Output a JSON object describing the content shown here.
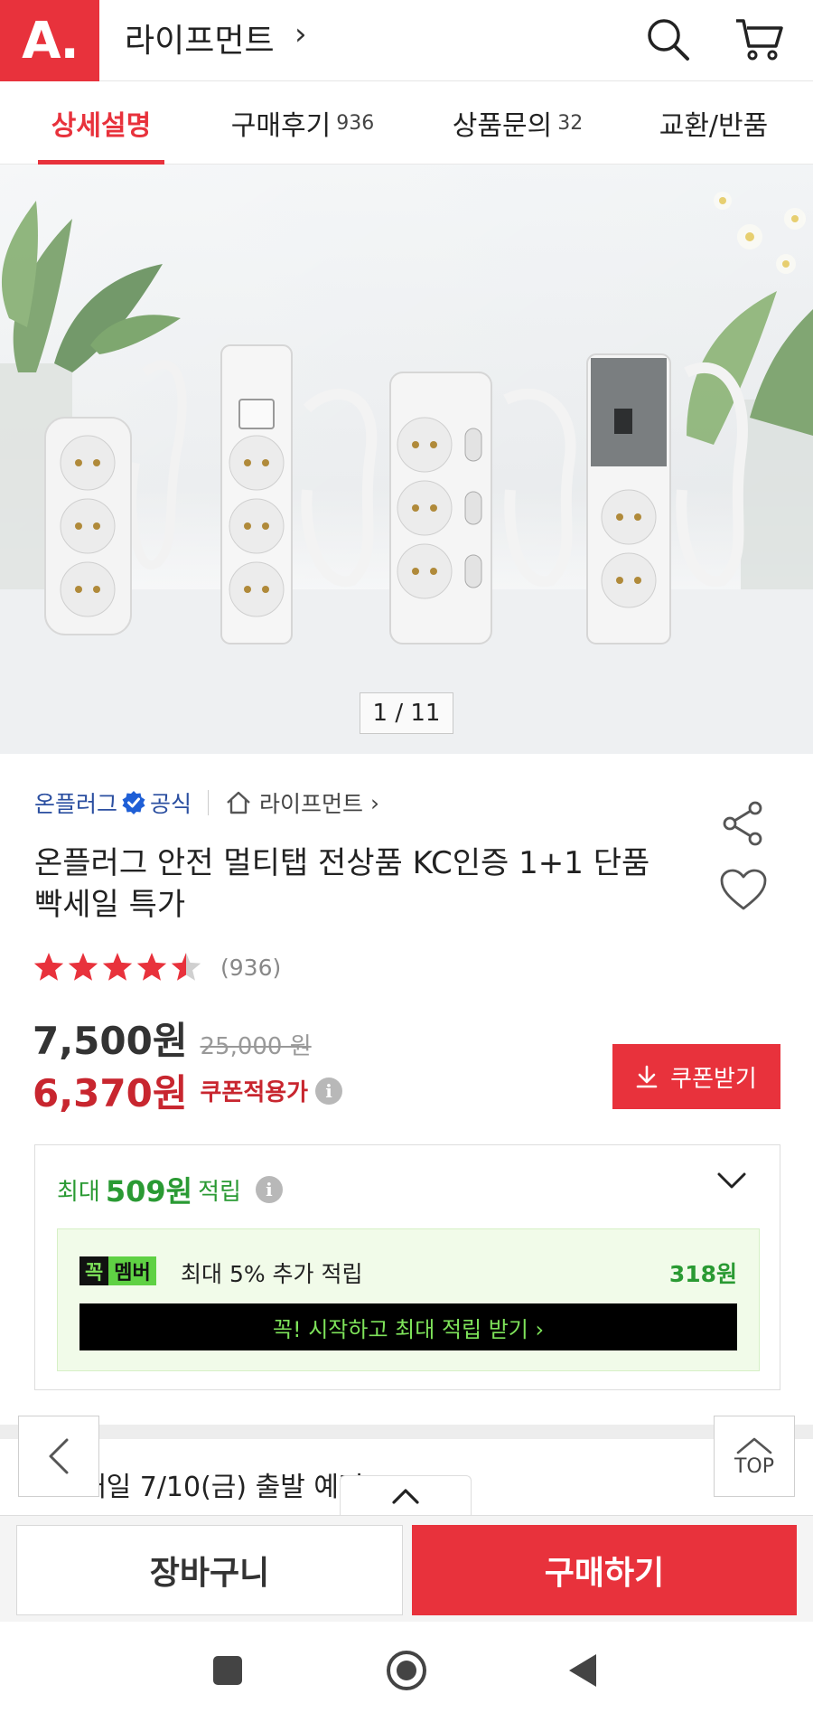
{
  "header": {
    "logo_text": "A.",
    "store_name": "라이프먼트",
    "store_chevron": "›"
  },
  "tabs": [
    {
      "label": "상세설명",
      "count": ""
    },
    {
      "label": "구매후기",
      "count": "936"
    },
    {
      "label": "상품문의",
      "count": "32"
    },
    {
      "label": "교환/반품",
      "count": ""
    }
  ],
  "hero": {
    "counter": "1 / 11"
  },
  "seller": {
    "brand": "온플러그",
    "official": "공식",
    "shop": "라이프먼트",
    "chevron": "›"
  },
  "product": {
    "title": "온플러그 안전 멀티탭 전상품 KC인증 1+1 단품 빡세일 특가",
    "rating_value": 4.5,
    "review_count": "(936)"
  },
  "price": {
    "sale": "7,500원",
    "original": "25,000 원",
    "coupon_price": "6,370원",
    "coupon_label": "쿠폰적용가",
    "info": "i",
    "coupon_button": "쿠폰받기"
  },
  "reward": {
    "prefix": "최대",
    "amount": "509원",
    "suffix": "적립",
    "member_tag_1": "꼭",
    "member_tag_2": "멤버",
    "member_text": "최대 5% 추가 적립",
    "member_amount": "318원",
    "member_cta": "꼭! 시작하고 최대 적립 받기 ›"
  },
  "shipping": {
    "text": "내일 7/10(금) 출발 예정"
  },
  "floating": {
    "top_label": "TOP"
  },
  "bottom_bar": {
    "cart": "장바구니",
    "buy": "구매하기"
  },
  "colors": {
    "brand_red": "#e8323c",
    "price_red": "#c8262f",
    "reward_green": "#2a9a33",
    "seller_blue": "#2a4ea0"
  }
}
